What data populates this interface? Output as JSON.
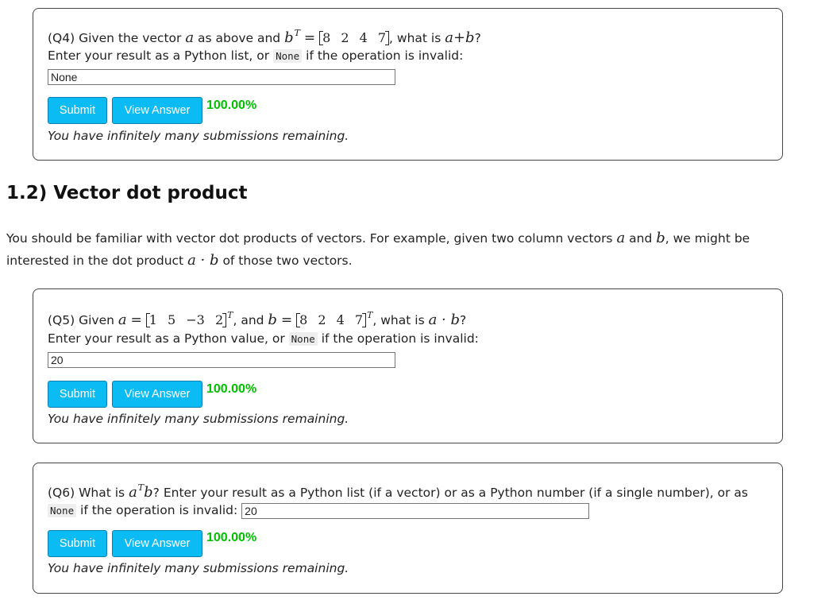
{
  "q4": {
    "prefix": "(Q4) Given the vector",
    "mid": "as above and",
    "b_values": "8 2 4 7",
    "suffix": ", what is",
    "expr": "a+b",
    "q": "?",
    "instruction_pre": "Enter your result as a Python list, or",
    "none_code": "None",
    "instruction_post": "if the operation is invalid:",
    "input_value": "None",
    "submit_label": "Submit",
    "view_label": "View Answer",
    "score": "100.00%",
    "remaining": "You have infinitely many submissions remaining."
  },
  "section": {
    "title": "1.2) Vector dot product",
    "para_1": "You should be familiar with vector dot products of vectors. For example, given two column vectors",
    "para_and": "and",
    "para_2": ", we might be interested in the dot product",
    "para_3": "of those two vectors."
  },
  "q5": {
    "prefix": "(Q5) Given",
    "a_values": "1 5 −3 2",
    "and_text": ", and",
    "b_values": "8 2 4 7",
    "suffix": ", what is",
    "q": "?",
    "instruction_pre": "Enter your result as a Python value, or",
    "none_code": "None",
    "instruction_post": "if the operation is invalid:",
    "input_value": "20",
    "submit_label": "Submit",
    "view_label": "View Answer",
    "score": "100.00%",
    "remaining": "You have infinitely many submissions remaining."
  },
  "q6": {
    "prefix": "(Q6) What is",
    "text": "? Enter your result as a Python list (if a vector) or as a Python number (if a single number), or as",
    "none_code": "None",
    "instruction_post": "if the operation is invalid:",
    "input_value": "20",
    "submit_label": "Submit",
    "view_label": "View Answer",
    "score": "100.00%",
    "remaining": "You have infinitely many submissions remaining."
  },
  "colors": {
    "button_bg": "#0bbcf4",
    "score_green": "#00c000",
    "border": "#444444"
  }
}
